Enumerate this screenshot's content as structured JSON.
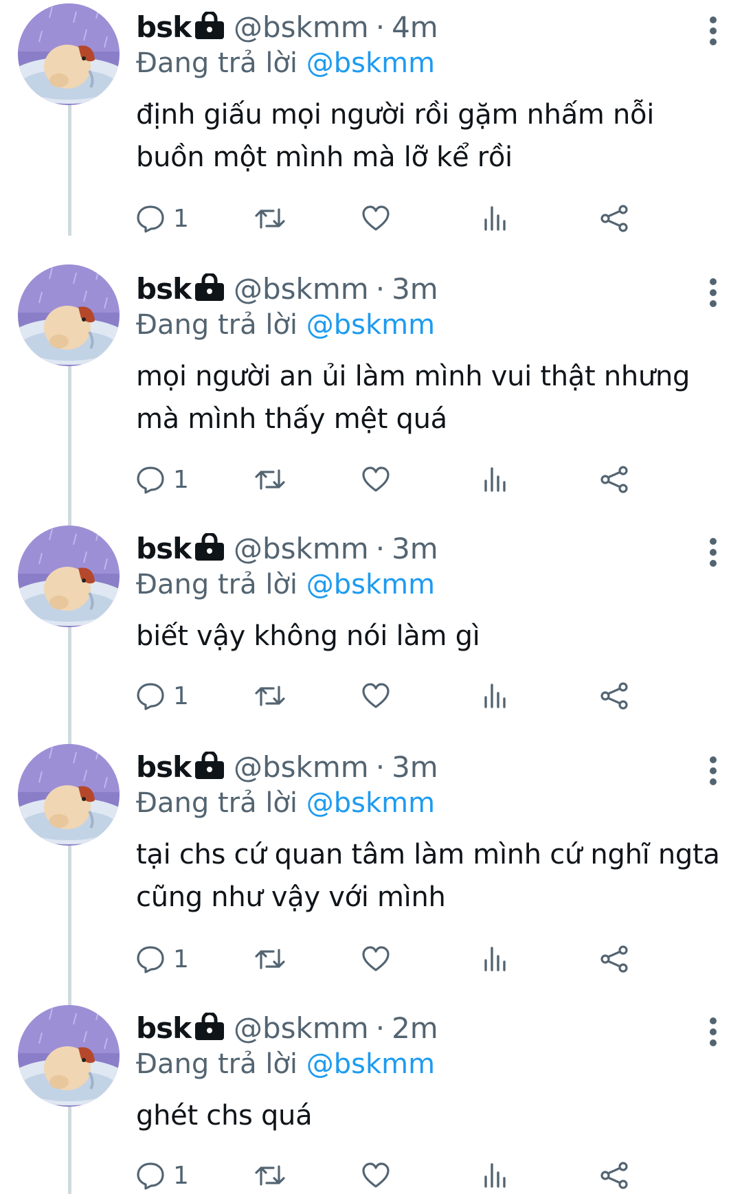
{
  "tweets": [
    {
      "name": "bsk",
      "handle": "@bskmm",
      "separator": "·",
      "time": "4m",
      "reply_prefix": "Đang trả lời",
      "reply_to": "@bskmm",
      "text": "định giấu mọi người rồi gặm nhấm nỗi buồn một mình mà lỡ kể rồi",
      "reply_count": "1"
    },
    {
      "name": "bsk",
      "handle": "@bskmm",
      "separator": "·",
      "time": "3m",
      "reply_prefix": "Đang trả lời",
      "reply_to": "@bskmm",
      "text": "mọi người an ủi làm mình vui thật nhưng mà mình thấy mệt quá",
      "reply_count": "1"
    },
    {
      "name": "bsk",
      "handle": "@bskmm",
      "separator": "·",
      "time": "3m",
      "reply_prefix": "Đang trả lời",
      "reply_to": "@bskmm",
      "text": "biết vậy không nói làm gì",
      "reply_count": "1"
    },
    {
      "name": "bsk",
      "handle": "@bskmm",
      "separator": "·",
      "time": "3m",
      "reply_prefix": "Đang trả lời",
      "reply_to": "@bskmm",
      "text": "tại chs cứ quan tâm làm mình cứ nghĩ ngta cũng như vậy với mình",
      "reply_count": "1"
    },
    {
      "name": "bsk",
      "handle": "@bskmm",
      "separator": "·",
      "time": "2m",
      "reply_prefix": "Đang trả lời",
      "reply_to": "@bskmm",
      "text": "ghét chs quá",
      "reply_count": "1"
    }
  ],
  "colors": {
    "text": "#0f1419",
    "secondary": "#536471",
    "link": "#1d9bf0",
    "thread_line": "#cfd9de"
  },
  "icons": {
    "protected": "lock-icon",
    "more": "more-vertical-icon",
    "reply": "reply-bubble-icon",
    "retweet": "retweet-icon",
    "like": "heart-icon",
    "views": "views-bar-icon",
    "share": "share-icon"
  }
}
